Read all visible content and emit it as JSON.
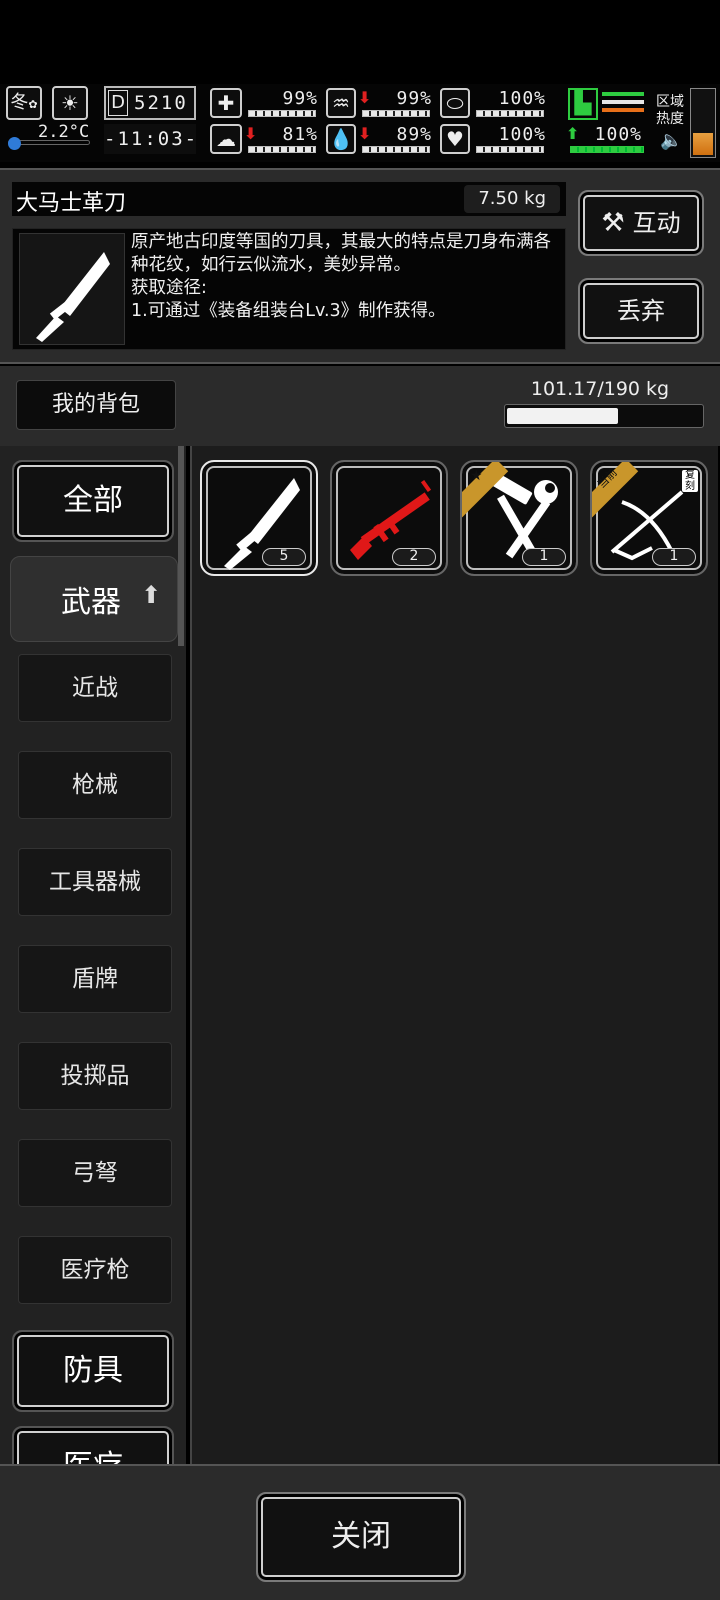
{
  "status": {
    "season": "冬",
    "temperature": "2.2°C",
    "day_code": "5210",
    "time": "-11:03-",
    "health_pct": "99%",
    "hunger_pct": "99%",
    "mood_pct": "100%",
    "sickness_pct": "81%",
    "thirst_pct": "89%",
    "heart_pct": "100%",
    "stamina_pct": "100%",
    "zone_heat_label": "区域\n热度"
  },
  "item": {
    "name": "大马士革刀",
    "weight": "7.50 kg",
    "description": "原产地古印度等国的刀具，其最大的特点是刀身布满各种花纹，如行云似流水，美妙异常。",
    "obtain_title": "获取途径:",
    "obtain_line": "1.可通过《装备组装台Lv.3》制作获得。",
    "icon": "knife-icon"
  },
  "actions": {
    "interact": "互动",
    "discard": "丢弃",
    "close": "关闭"
  },
  "bag": {
    "tab_label": "我的背包",
    "capacity": "101.17/190 kg",
    "fill_fraction": 0.532
  },
  "categories": {
    "all": "全部",
    "weapons": "武器",
    "sub": [
      "近战",
      "枪械",
      "工具器械",
      "盾牌",
      "投掷品",
      "弓弩",
      "医疗枪"
    ],
    "armor": "防具",
    "medical": "医疗"
  },
  "slots": [
    {
      "icon": "knife-icon",
      "count": "5",
      "selected": true
    },
    {
      "icon": "rifle-icon",
      "count": "2"
    },
    {
      "icon": "hammer-wrench-icon",
      "count": "1",
      "badge": "star"
    },
    {
      "icon": "crossbow-icon",
      "count": "1",
      "badge": "当前",
      "tag": "复刻"
    }
  ],
  "colors": {
    "accent_gold": "#c9962b",
    "rifle_red": "#e01818",
    "green": "#2ecc40"
  }
}
